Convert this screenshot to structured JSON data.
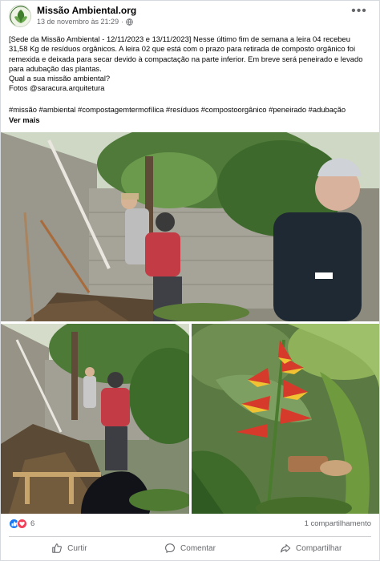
{
  "post": {
    "page_name": "Missão Ambiental.org",
    "timestamp": "13 de novembro às 21:29",
    "privacy_icon": "globe-icon",
    "menu_icon": "more-horizontal-icon",
    "paragraphs": [
      "[Sede da Missão Ambiental - 12/11/2023 e 13/11/2023] Nesse último fim de semana a leira 04 recebeu 31,58 Kg de resíduos orgânicos. A leira 02 que está com o prazo para retirada de composto orgânico foi remexida e deixada para secar devido à compactação na parte inferior. Em breve será peneirado e levado para adubação das plantas.",
      "Qual a sua missão ambiental?",
      "Fotos @saracura.arquitetura"
    ],
    "hashtags": "#missão #ambiental #compostagemtermofílica #resíduos #compostoorgânico #peneirado #adubação",
    "see_more": "Ver mais"
  },
  "photos": [
    {
      "icon": "photo-compost-area-wide"
    },
    {
      "icon": "photo-compost-pile"
    },
    {
      "icon": "photo-heliconia-flower"
    }
  ],
  "stats": {
    "reaction_icons": [
      "like-icon",
      "love-icon"
    ],
    "reaction_count": "6",
    "shares": "1 compartilhamento"
  },
  "actions": {
    "like": "Curtir",
    "comment": "Comentar",
    "share": "Compartilhar"
  },
  "colors": {
    "accent": "#1877f2",
    "love": "#f33e58",
    "secondary_text": "#65676b"
  }
}
